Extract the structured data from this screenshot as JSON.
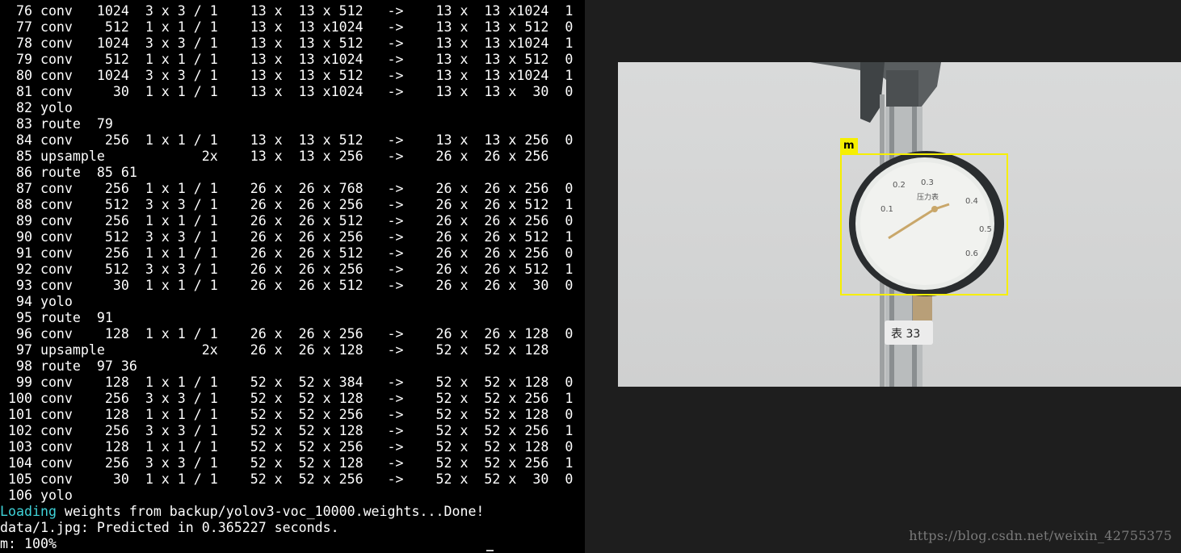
{
  "terminal": {
    "lines": [
      "  76 conv   1024  3 x 3 / 1    13 x  13 x 512   ->    13 x  13 x1024  1",
      "  77 conv    512  1 x 1 / 1    13 x  13 x1024   ->    13 x  13 x 512  0",
      "  78 conv   1024  3 x 3 / 1    13 x  13 x 512   ->    13 x  13 x1024  1",
      "  79 conv    512  1 x 1 / 1    13 x  13 x1024   ->    13 x  13 x 512  0",
      "  80 conv   1024  3 x 3 / 1    13 x  13 x 512   ->    13 x  13 x1024  1",
      "  81 conv     30  1 x 1 / 1    13 x  13 x1024   ->    13 x  13 x  30  0",
      "  82 yolo",
      "  83 route  79",
      "  84 conv    256  1 x 1 / 1    13 x  13 x 512   ->    13 x  13 x 256  0",
      "  85 upsample            2x    13 x  13 x 256   ->    26 x  26 x 256",
      "  86 route  85 61",
      "  87 conv    256  1 x 1 / 1    26 x  26 x 768   ->    26 x  26 x 256  0",
      "  88 conv    512  3 x 3 / 1    26 x  26 x 256   ->    26 x  26 x 512  1",
      "  89 conv    256  1 x 1 / 1    26 x  26 x 512   ->    26 x  26 x 256  0",
      "  90 conv    512  3 x 3 / 1    26 x  26 x 256   ->    26 x  26 x 512  1",
      "  91 conv    256  1 x 1 / 1    26 x  26 x 512   ->    26 x  26 x 256  0",
      "  92 conv    512  3 x 3 / 1    26 x  26 x 256   ->    26 x  26 x 512  1",
      "  93 conv     30  1 x 1 / 1    26 x  26 x 512   ->    26 x  26 x  30  0",
      "  94 yolo",
      "  95 route  91",
      "  96 conv    128  1 x 1 / 1    26 x  26 x 256   ->    26 x  26 x 128  0",
      "  97 upsample            2x    26 x  26 x 128   ->    52 x  52 x 128",
      "  98 route  97 36",
      "  99 conv    128  1 x 1 / 1    52 x  52 x 384   ->    52 x  52 x 128  0",
      " 100 conv    256  3 x 3 / 1    52 x  52 x 128   ->    52 x  52 x 256  1",
      " 101 conv    128  1 x 1 / 1    52 x  52 x 256   ->    52 x  52 x 128  0",
      " 102 conv    256  3 x 3 / 1    52 x  52 x 128   ->    52 x  52 x 256  1",
      " 103 conv    128  1 x 1 / 1    52 x  52 x 256   ->    52 x  52 x 128  0",
      " 104 conv    256  3 x 3 / 1    52 x  52 x 128   ->    52 x  52 x 256  1",
      " 105 conv     30  1 x 1 / 1    52 x  52 x 256   ->    52 x  52 x  30  0",
      " 106 yolo"
    ],
    "loading_word": "Loading",
    "loading_rest": " weights from backup/yolov3-voc_10000.weights...Done!",
    "predicted_line": "data/1.jpg: Predicted in 0.365227 seconds.",
    "result_line": "m: 100%",
    "loading_color": "#3fd2d8"
  },
  "photo": {
    "detection_label": "m",
    "box_color": "#f6ef00",
    "gauge": {
      "ticks": [
        "0.1",
        "0.2",
        "0.3",
        "0.4",
        "0.5",
        "0.6"
      ],
      "face_title": "压力表",
      "tag_text": "表 33"
    }
  },
  "watermark": "https://blog.csdn.net/weixin_42755375"
}
